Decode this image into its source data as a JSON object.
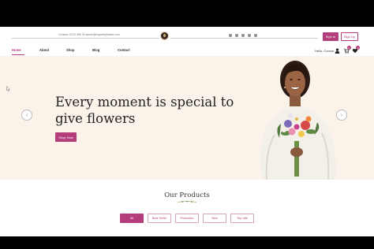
{
  "header": {
    "contact": "Contact: 0123 456 78     admin@myprettyflower.com",
    "socials": [
      "facebook-icon",
      "x-icon",
      "linkedin-icon",
      "pinterest-icon",
      "instagram-icon"
    ],
    "signin_label": "Sign In",
    "signup_label": "Sign Up"
  },
  "nav": {
    "items": [
      "Home",
      "About",
      "Shop",
      "Blog",
      "Contact"
    ],
    "greeting": "Hello, Connor",
    "cart_count": "0",
    "wishlist_count": "0"
  },
  "hero": {
    "title": "Every moment is special to give flowers",
    "button_label": "Shop Now"
  },
  "products": {
    "title": "Our Products",
    "tabs": [
      "All",
      "Best Seller",
      "Promotion",
      "New",
      "Top rate"
    ]
  },
  "colors": {
    "accent": "#b43d7c",
    "hero_bg": "#fbf3ea"
  }
}
